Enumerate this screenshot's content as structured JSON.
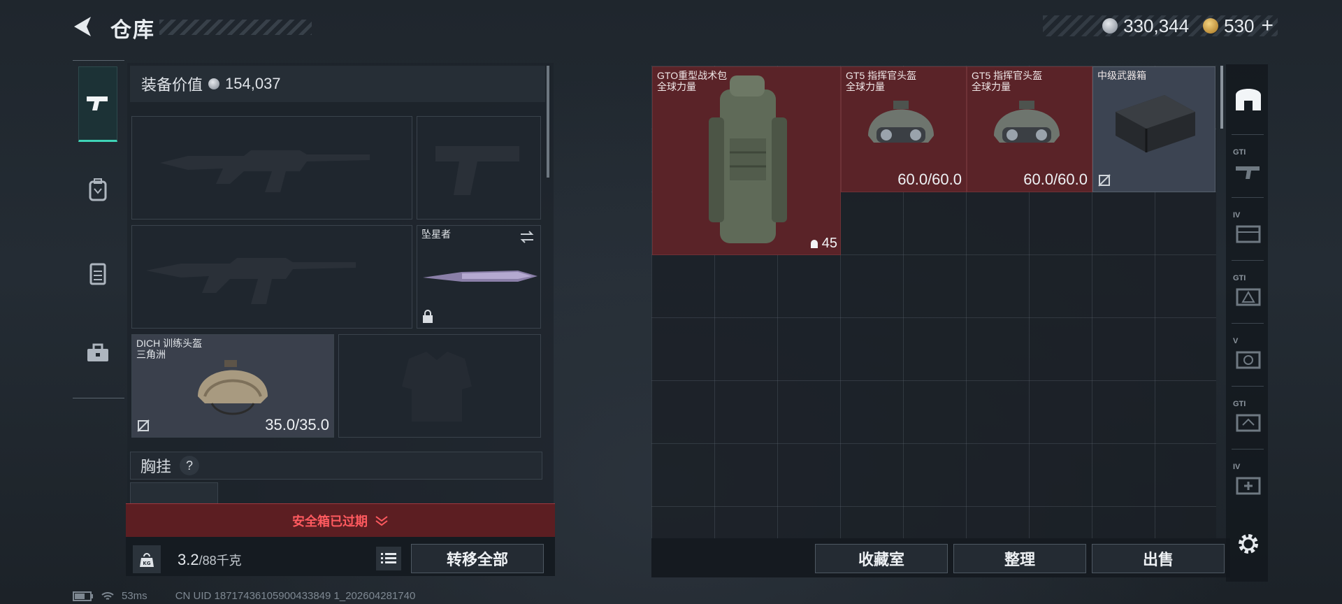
{
  "header": {
    "title": "仓库",
    "currency": [
      {
        "icon": "silver-coin-icon",
        "value": "330,344"
      },
      {
        "icon": "gold-coin-icon",
        "value": "530"
      }
    ],
    "add_symbol": "+"
  },
  "categories": [
    {
      "icon": "pistol-icon",
      "active": true
    },
    {
      "icon": "backpack-icon",
      "active": false
    },
    {
      "icon": "vest-icon",
      "active": false
    },
    {
      "icon": "toolbox-icon",
      "active": false
    }
  ],
  "equipment": {
    "value_label": "装备价值",
    "value": "154,037",
    "melee": {
      "name": "坠星者"
    },
    "helmet": {
      "name": "DICH 训练头盔",
      "sub": "三角洲",
      "durability": "35.0/35.0"
    },
    "chest_label": "胸挂",
    "help_symbol": "?"
  },
  "safebox": {
    "warning": "安全箱已过期"
  },
  "weight": {
    "current": "3.2",
    "max": "/88千克",
    "kg_icon_text": "KG"
  },
  "buttons": {
    "transfer_all": "转移全部",
    "collection": "收藏室",
    "organize": "整理",
    "sell": "出售"
  },
  "storage_items": [
    {
      "name": "GTO重型战术包",
      "sub": "全球力量",
      "count": "45",
      "highlight": "red"
    },
    {
      "name": "GT5 指挥官头盔",
      "sub": "全球力量",
      "durability": "60.0/60.0",
      "highlight": "red"
    },
    {
      "name": "GT5 指挥官头盔",
      "sub": "全球力量",
      "durability": "60.0/60.0",
      "highlight": "red"
    },
    {
      "name": "中级武器箱",
      "highlight": "neutral"
    }
  ],
  "filters": [
    {
      "label": "",
      "icon": "storage-filter-icon"
    },
    {
      "label": "GTI",
      "icon": "rifle-filter-icon"
    },
    {
      "label": "IV",
      "icon": "case-filter-icon"
    },
    {
      "label": "GTI",
      "icon": "warning-box-filter-icon"
    },
    {
      "label": "V",
      "icon": "target-filter-icon"
    },
    {
      "label": "GTI",
      "icon": "gear-box-filter-icon"
    },
    {
      "label": "IV",
      "icon": "medkit-filter-icon"
    }
  ],
  "status": {
    "ping": "53ms",
    "uid": "CN UID 18717436105900433849 1_202604281740"
  },
  "colors": {
    "accent_teal": "#3fd3b6",
    "item_red": "#5a2328",
    "warning_red": "#ff5a5f"
  }
}
